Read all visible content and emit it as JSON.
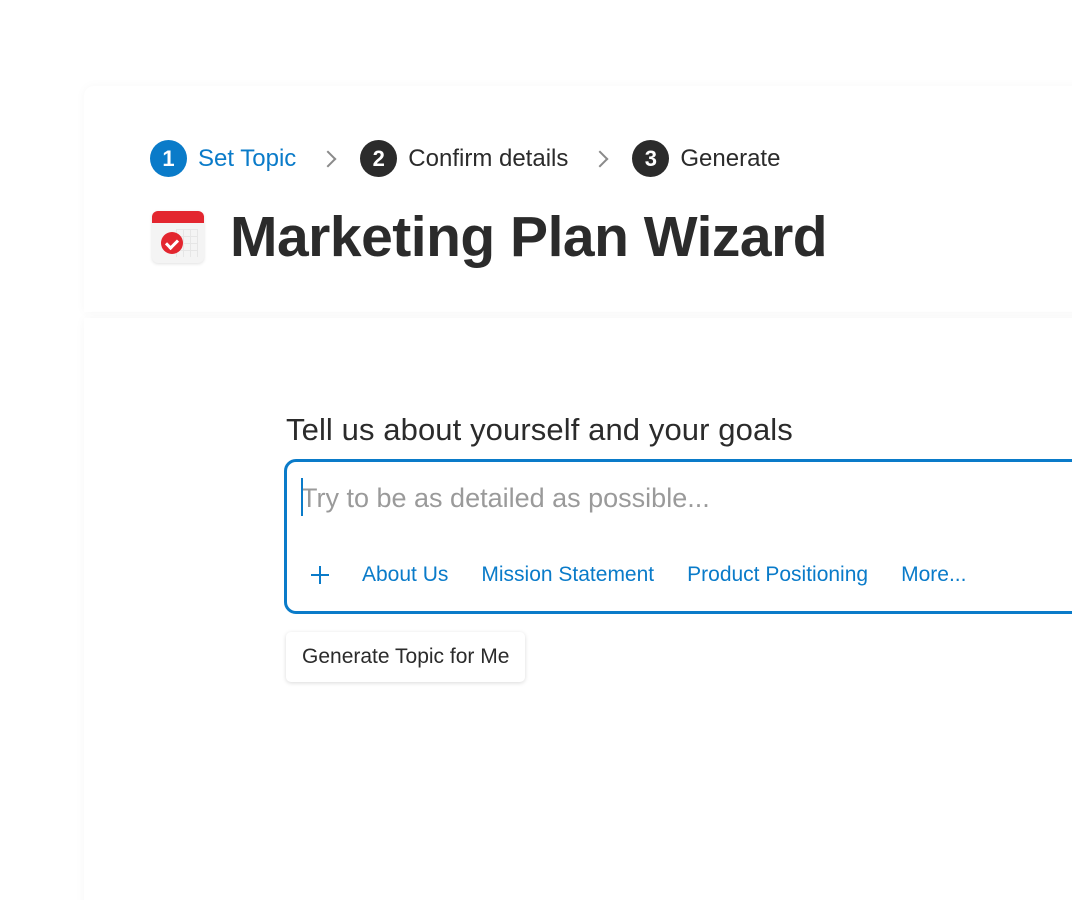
{
  "stepper": {
    "steps": [
      {
        "number": "1",
        "label": "Set Topic",
        "active": true
      },
      {
        "number": "2",
        "label": "Confirm details",
        "active": false
      },
      {
        "number": "3",
        "label": "Generate",
        "active": false
      }
    ]
  },
  "header": {
    "title": "Marketing Plan Wizard",
    "icon": "calendar-check-icon"
  },
  "form": {
    "label": "Tell us about yourself and your goals",
    "input": {
      "value": "",
      "placeholder": "Try to be as detailed as possible..."
    },
    "chips": [
      "About Us",
      "Mission Statement",
      "Product Positioning",
      "More..."
    ],
    "generate_button": "Generate Topic for Me"
  },
  "colors": {
    "accent": "#0a7bc9",
    "text": "#2b2b2b",
    "calendar_red": "#e3262f",
    "placeholder": "#9a9a9a"
  }
}
